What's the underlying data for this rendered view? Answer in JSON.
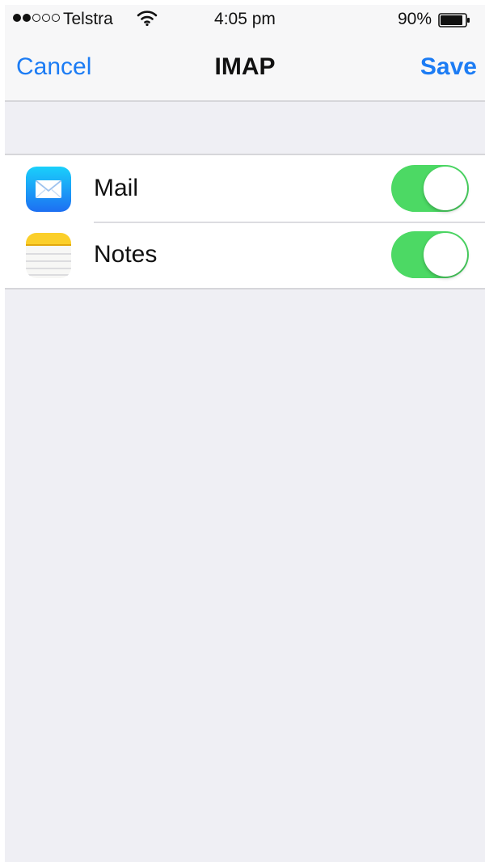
{
  "status_bar": {
    "carrier": "Telstra",
    "signal_bars_filled": 2,
    "signal_bars_total": 5,
    "wifi_icon": "wifi-icon",
    "time": "4:05 pm",
    "battery_percent": "90%",
    "battery_level": 0.9
  },
  "nav": {
    "cancel_label": "Cancel",
    "title": "IMAP",
    "save_label": "Save",
    "accent_color": "#1c7cf4"
  },
  "rows": [
    {
      "label": "Mail",
      "icon": "mail-app-icon",
      "toggle_on": true
    },
    {
      "label": "Notes",
      "icon": "notes-app-icon",
      "toggle_on": true
    }
  ],
  "colors": {
    "toggle_on": "#4cd964",
    "background": "#efeff4"
  }
}
